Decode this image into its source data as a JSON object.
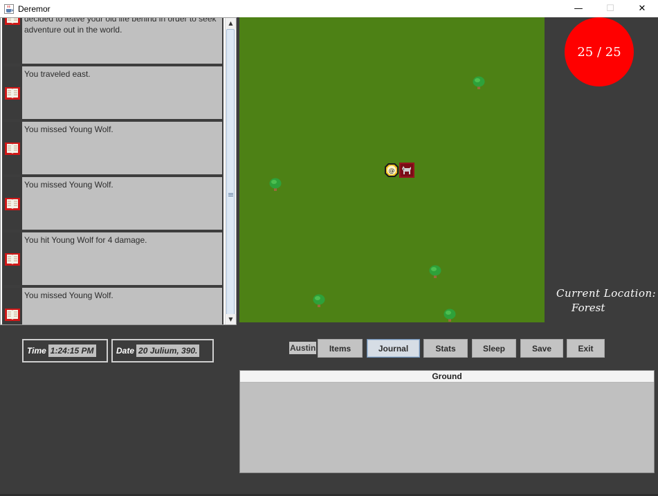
{
  "window": {
    "title": "Deremor",
    "app_icon": "java-cup-icon",
    "controls": {
      "minimize": "—",
      "maximize": "☐",
      "close": "✕"
    }
  },
  "log": {
    "entries": [
      {
        "text": "decided to leave your old life behind in order to seek adventure out in the world.",
        "icon": "journal-book-icon"
      },
      {
        "text": "You traveled east.",
        "icon": "journal-book-icon"
      },
      {
        "text": "You missed Young Wolf.",
        "icon": "journal-book-icon"
      },
      {
        "text": "You missed Young Wolf.",
        "icon": "journal-book-icon"
      },
      {
        "text": "You hit Young Wolf for 4 damage.",
        "icon": "journal-book-icon"
      },
      {
        "text": "You missed Young Wolf.",
        "icon": "journal-book-icon"
      }
    ],
    "scroll_up": "▲",
    "scroll_down": "▼"
  },
  "map": {
    "terrain_color": "#4d8115",
    "player_symbol": "@",
    "enemy_icon": "wolf-icon",
    "tree_icon": "tree-icon"
  },
  "stats": {
    "hp_text": "25 / 25",
    "hp_color": "#ff0000",
    "location_label": "Current Location:",
    "location_value": "Forest"
  },
  "time": {
    "label": "Time",
    "value": "1:24:15 PM"
  },
  "date": {
    "label": "Date",
    "value": "20 Julium, 390."
  },
  "toolbar": {
    "character_name": "Austin",
    "buttons": {
      "items": "Items",
      "journal": "Journal",
      "stats": "Stats",
      "sleep": "Sleep",
      "save": "Save",
      "exit": "Exit"
    },
    "active": "Journal"
  },
  "ground": {
    "header": "Ground"
  }
}
